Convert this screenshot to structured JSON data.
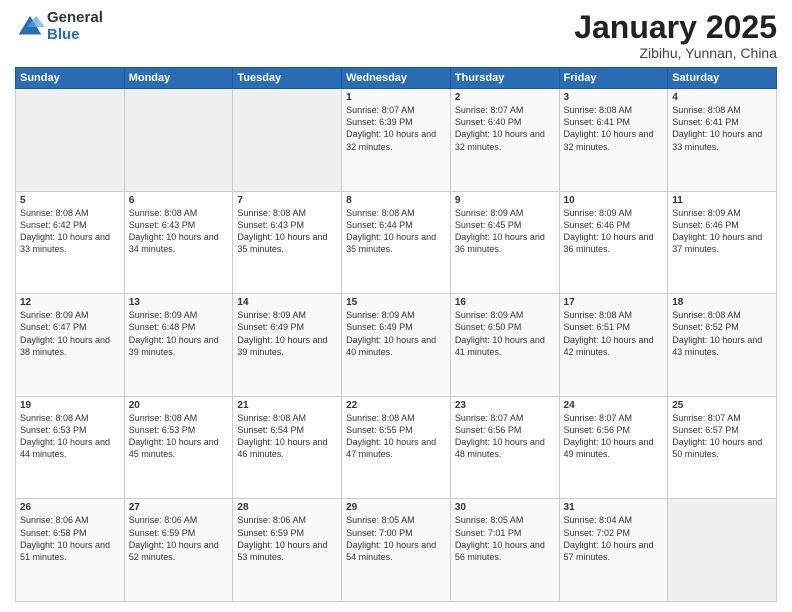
{
  "logo": {
    "general": "General",
    "blue": "Blue"
  },
  "title": "January 2025",
  "subtitle": "Zibihu, Yunnan, China",
  "headers": [
    "Sunday",
    "Monday",
    "Tuesday",
    "Wednesday",
    "Thursday",
    "Friday",
    "Saturday"
  ],
  "weeks": [
    [
      {
        "day": "",
        "sunrise": "",
        "sunset": "",
        "daylight": "",
        "empty": true
      },
      {
        "day": "",
        "sunrise": "",
        "sunset": "",
        "daylight": "",
        "empty": true
      },
      {
        "day": "",
        "sunrise": "",
        "sunset": "",
        "daylight": "",
        "empty": true
      },
      {
        "day": "1",
        "sunrise": "Sunrise: 8:07 AM",
        "sunset": "Sunset: 6:39 PM",
        "daylight": "Daylight: 10 hours and 32 minutes.",
        "empty": false
      },
      {
        "day": "2",
        "sunrise": "Sunrise: 8:07 AM",
        "sunset": "Sunset: 6:40 PM",
        "daylight": "Daylight: 10 hours and 32 minutes.",
        "empty": false
      },
      {
        "day": "3",
        "sunrise": "Sunrise: 8:08 AM",
        "sunset": "Sunset: 6:41 PM",
        "daylight": "Daylight: 10 hours and 32 minutes.",
        "empty": false
      },
      {
        "day": "4",
        "sunrise": "Sunrise: 8:08 AM",
        "sunset": "Sunset: 6:41 PM",
        "daylight": "Daylight: 10 hours and 33 minutes.",
        "empty": false
      }
    ],
    [
      {
        "day": "5",
        "sunrise": "Sunrise: 8:08 AM",
        "sunset": "Sunset: 6:42 PM",
        "daylight": "Daylight: 10 hours and 33 minutes.",
        "empty": false
      },
      {
        "day": "6",
        "sunrise": "Sunrise: 8:08 AM",
        "sunset": "Sunset: 6:43 PM",
        "daylight": "Daylight: 10 hours and 34 minutes.",
        "empty": false
      },
      {
        "day": "7",
        "sunrise": "Sunrise: 8:08 AM",
        "sunset": "Sunset: 6:43 PM",
        "daylight": "Daylight: 10 hours and 35 minutes.",
        "empty": false
      },
      {
        "day": "8",
        "sunrise": "Sunrise: 8:08 AM",
        "sunset": "Sunset: 6:44 PM",
        "daylight": "Daylight: 10 hours and 35 minutes.",
        "empty": false
      },
      {
        "day": "9",
        "sunrise": "Sunrise: 8:09 AM",
        "sunset": "Sunset: 6:45 PM",
        "daylight": "Daylight: 10 hours and 36 minutes.",
        "empty": false
      },
      {
        "day": "10",
        "sunrise": "Sunrise: 8:09 AM",
        "sunset": "Sunset: 6:46 PM",
        "daylight": "Daylight: 10 hours and 36 minutes.",
        "empty": false
      },
      {
        "day": "11",
        "sunrise": "Sunrise: 8:09 AM",
        "sunset": "Sunset: 6:46 PM",
        "daylight": "Daylight: 10 hours and 37 minutes.",
        "empty": false
      }
    ],
    [
      {
        "day": "12",
        "sunrise": "Sunrise: 8:09 AM",
        "sunset": "Sunset: 6:47 PM",
        "daylight": "Daylight: 10 hours and 38 minutes.",
        "empty": false
      },
      {
        "day": "13",
        "sunrise": "Sunrise: 8:09 AM",
        "sunset": "Sunset: 6:48 PM",
        "daylight": "Daylight: 10 hours and 39 minutes.",
        "empty": false
      },
      {
        "day": "14",
        "sunrise": "Sunrise: 8:09 AM",
        "sunset": "Sunset: 6:49 PM",
        "daylight": "Daylight: 10 hours and 39 minutes.",
        "empty": false
      },
      {
        "day": "15",
        "sunrise": "Sunrise: 8:09 AM",
        "sunset": "Sunset: 6:49 PM",
        "daylight": "Daylight: 10 hours and 40 minutes.",
        "empty": false
      },
      {
        "day": "16",
        "sunrise": "Sunrise: 8:09 AM",
        "sunset": "Sunset: 6:50 PM",
        "daylight": "Daylight: 10 hours and 41 minutes.",
        "empty": false
      },
      {
        "day": "17",
        "sunrise": "Sunrise: 8:08 AM",
        "sunset": "Sunset: 6:51 PM",
        "daylight": "Daylight: 10 hours and 42 minutes.",
        "empty": false
      },
      {
        "day": "18",
        "sunrise": "Sunrise: 8:08 AM",
        "sunset": "Sunset: 6:52 PM",
        "daylight": "Daylight: 10 hours and 43 minutes.",
        "empty": false
      }
    ],
    [
      {
        "day": "19",
        "sunrise": "Sunrise: 8:08 AM",
        "sunset": "Sunset: 6:53 PM",
        "daylight": "Daylight: 10 hours and 44 minutes.",
        "empty": false
      },
      {
        "day": "20",
        "sunrise": "Sunrise: 8:08 AM",
        "sunset": "Sunset: 6:53 PM",
        "daylight": "Daylight: 10 hours and 45 minutes.",
        "empty": false
      },
      {
        "day": "21",
        "sunrise": "Sunrise: 8:08 AM",
        "sunset": "Sunset: 6:54 PM",
        "daylight": "Daylight: 10 hours and 46 minutes.",
        "empty": false
      },
      {
        "day": "22",
        "sunrise": "Sunrise: 8:08 AM",
        "sunset": "Sunset: 6:55 PM",
        "daylight": "Daylight: 10 hours and 47 minutes.",
        "empty": false
      },
      {
        "day": "23",
        "sunrise": "Sunrise: 8:07 AM",
        "sunset": "Sunset: 6:56 PM",
        "daylight": "Daylight: 10 hours and 48 minutes.",
        "empty": false
      },
      {
        "day": "24",
        "sunrise": "Sunrise: 8:07 AM",
        "sunset": "Sunset: 6:56 PM",
        "daylight": "Daylight: 10 hours and 49 minutes.",
        "empty": false
      },
      {
        "day": "25",
        "sunrise": "Sunrise: 8:07 AM",
        "sunset": "Sunset: 6:57 PM",
        "daylight": "Daylight: 10 hours and 50 minutes.",
        "empty": false
      }
    ],
    [
      {
        "day": "26",
        "sunrise": "Sunrise: 8:06 AM",
        "sunset": "Sunset: 6:58 PM",
        "daylight": "Daylight: 10 hours and 51 minutes.",
        "empty": false
      },
      {
        "day": "27",
        "sunrise": "Sunrise: 8:06 AM",
        "sunset": "Sunset: 6:59 PM",
        "daylight": "Daylight: 10 hours and 52 minutes.",
        "empty": false
      },
      {
        "day": "28",
        "sunrise": "Sunrise: 8:06 AM",
        "sunset": "Sunset: 6:59 PM",
        "daylight": "Daylight: 10 hours and 53 minutes.",
        "empty": false
      },
      {
        "day": "29",
        "sunrise": "Sunrise: 8:05 AM",
        "sunset": "Sunset: 7:00 PM",
        "daylight": "Daylight: 10 hours and 54 minutes.",
        "empty": false
      },
      {
        "day": "30",
        "sunrise": "Sunrise: 8:05 AM",
        "sunset": "Sunset: 7:01 PM",
        "daylight": "Daylight: 10 hours and 56 minutes.",
        "empty": false
      },
      {
        "day": "31",
        "sunrise": "Sunrise: 8:04 AM",
        "sunset": "Sunset: 7:02 PM",
        "daylight": "Daylight: 10 hours and 57 minutes.",
        "empty": false
      },
      {
        "day": "",
        "sunrise": "",
        "sunset": "",
        "daylight": "",
        "empty": true
      }
    ]
  ]
}
